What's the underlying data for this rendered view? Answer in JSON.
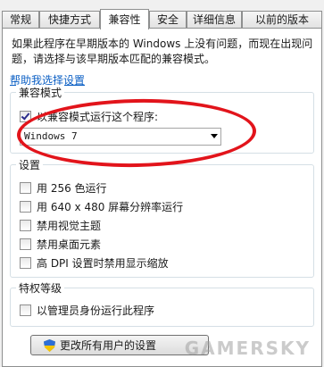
{
  "tabs": [
    "常规",
    "快捷方式",
    "兼容性",
    "安全",
    "详细信息",
    "以前的版本"
  ],
  "description": "如果此程序在早期版本的 Windows 上没有问题，而现在出现问题，请选择与该早期版本匹配的兼容模式。",
  "help_link": "帮助我选择设置",
  "compat_group": {
    "title": "兼容模式",
    "checkbox_label": "以兼容模式运行这个程序:",
    "checked": true,
    "selected_os": "Windows 7"
  },
  "settings_group": {
    "title": "设置",
    "items": [
      {
        "label": "用 256 色运行",
        "checked": false
      },
      {
        "label": "用 640 x 480 屏幕分辨率运行",
        "checked": false
      },
      {
        "label": "禁用视觉主题",
        "checked": false
      },
      {
        "label": "禁用桌面元素",
        "checked": false
      },
      {
        "label": "高 DPI 设置时禁用显示缩放",
        "checked": false
      }
    ]
  },
  "privilege_group": {
    "title": "特权等级",
    "checkbox_label": "以管理员身份运行此程序",
    "checked": false
  },
  "all_users_button": "更改所有用户的设置",
  "watermark": "GAMERSKY",
  "colors": {
    "highlight_ellipse": "#e2141b",
    "link": "#0b5fc4"
  }
}
